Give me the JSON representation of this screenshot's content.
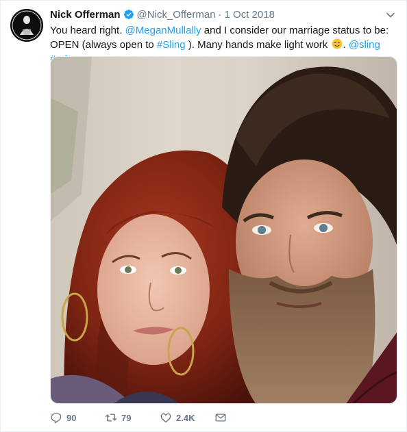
{
  "author": {
    "name": "Nick Offerman",
    "handle": "@Nick_Offerman",
    "separator": "·",
    "date": "1 Oct 2018"
  },
  "tweet_text": {
    "part1": "You heard right. ",
    "mention1": "@MeganMullally",
    "part2": "  and I consider our marriage status to be: OPEN (always open to ",
    "hashtag1": "#Sling",
    "part3": " ). Many hands make light work ",
    "part4": ". ",
    "mention2": "@sling",
    "space": " ",
    "hashtag2": "#ad"
  },
  "actions": {
    "reply_count": "90",
    "retweet_count": "79",
    "like_count": "2.4K"
  },
  "icons": {
    "verified": "verified-badge-icon",
    "caret": "chevron-down-icon",
    "reply": "reply-icon",
    "retweet": "retweet-icon",
    "like": "heart-icon",
    "message": "envelope-icon",
    "emoji": "winking-face-emoji"
  },
  "colors": {
    "link": "#1da1f2",
    "secondary_text": "#657786",
    "primary_text": "#14171a"
  }
}
